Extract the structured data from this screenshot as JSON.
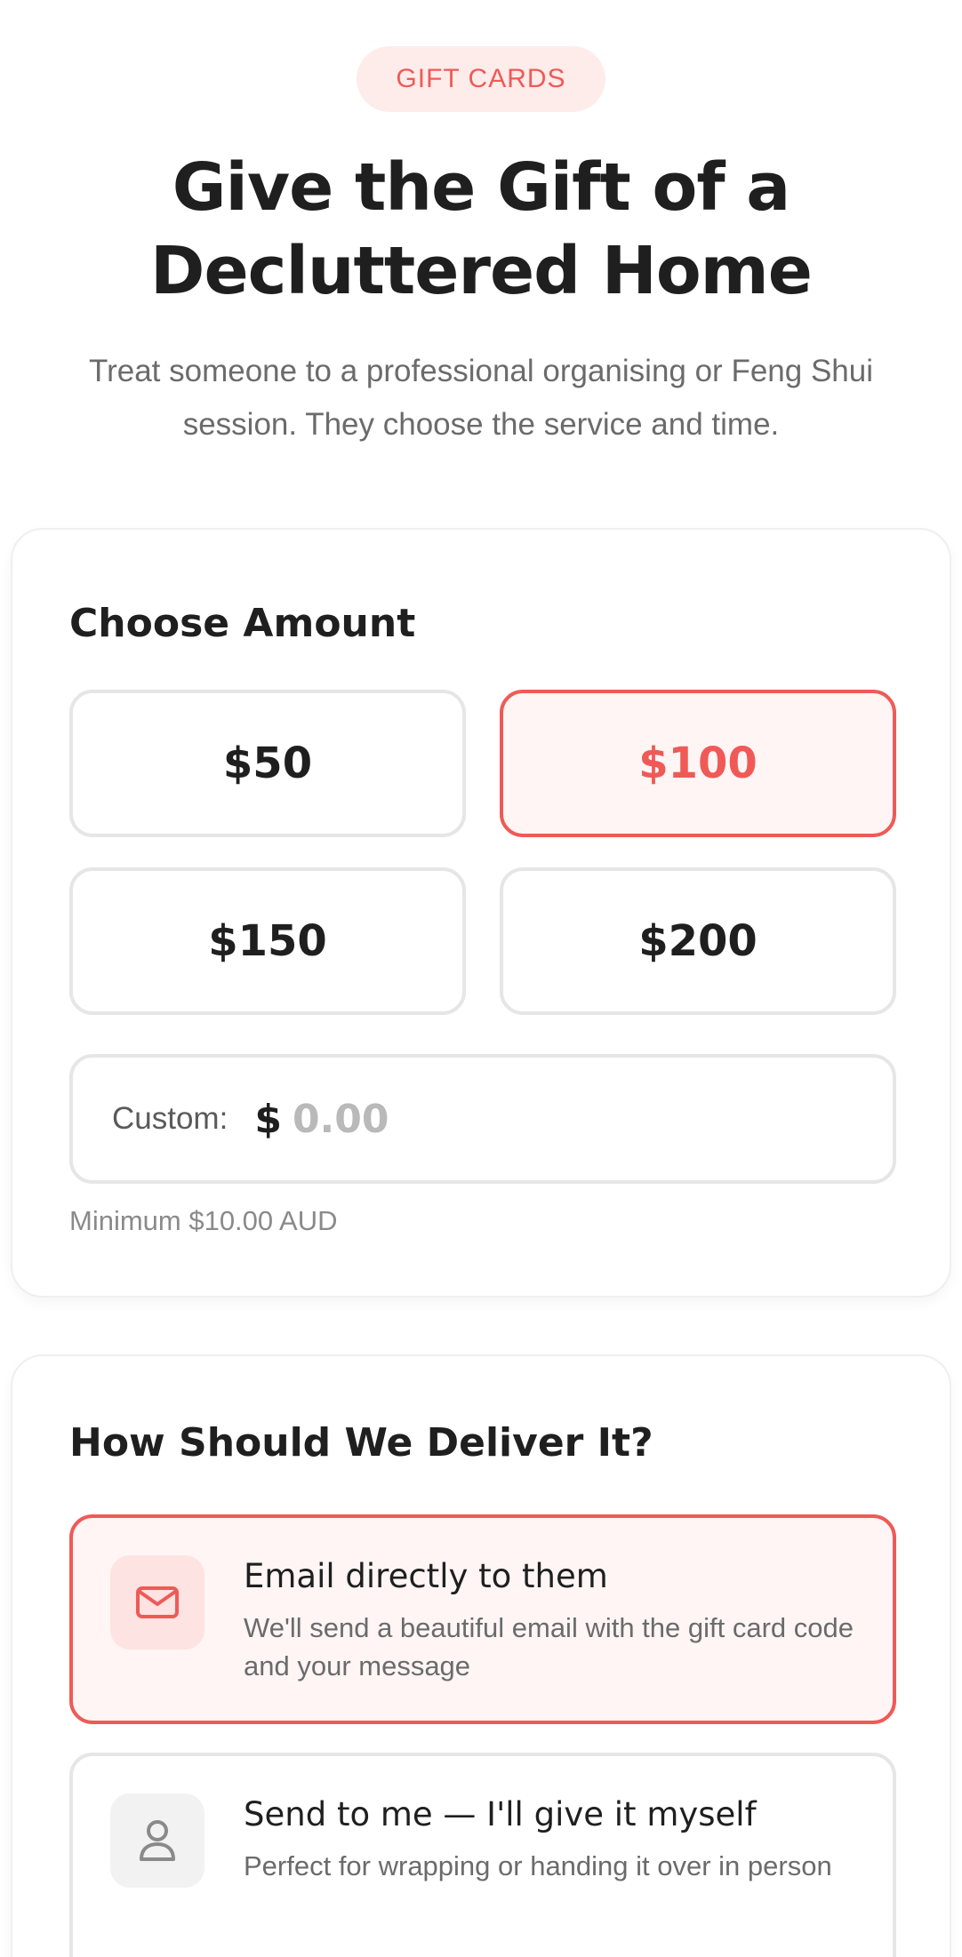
{
  "badge": "GIFT CARDS",
  "hero": {
    "title": "Give the Gift of a Decluttered Home",
    "subtitle": "Treat someone to a professional organising or Feng Shui session. They choose the service and time."
  },
  "amount": {
    "heading": "Choose Amount",
    "options": [
      "$50",
      "$100",
      "$150",
      "$200"
    ],
    "selected": "$100",
    "custom_label": "Custom:",
    "currency_symbol": "$",
    "custom_placeholder": "0.00",
    "custom_value": "",
    "hint": "Minimum $10.00 AUD"
  },
  "delivery": {
    "heading": "How Should We Deliver It?",
    "options": [
      {
        "icon": "envelope-icon",
        "title": "Email directly to them",
        "description": "We'll send a beautiful email with the gift card code and your message",
        "selected": true
      },
      {
        "icon": "person-icon",
        "title": "Send to me — I'll give it myself",
        "description": "Perfect for wrapping or handing it over in person",
        "selected": false
      }
    ]
  },
  "colors": {
    "accent": "#ef5a57",
    "accent_bg": "#fff5f5",
    "badge_bg": "#fdecea",
    "border": "#e6e6e6",
    "text": "#1f1f1f",
    "muted": "#6b6b6b"
  }
}
